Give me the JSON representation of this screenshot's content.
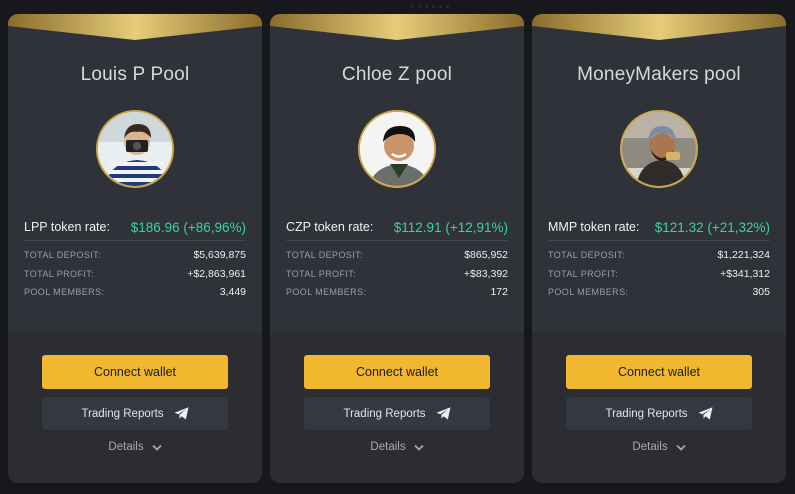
{
  "pools": [
    {
      "title": "Louis P Pool",
      "rate_label": "LPP token rate:",
      "rate_value": "$186.96 (+86,96%)",
      "total_deposit_label": "TOTAL DEPOSIT:",
      "total_deposit": "$5,639,875",
      "total_profit_label": "TOTAL PROFIT:",
      "total_profit": "+$2,863,961",
      "members_label": "POOL MEMBERS:",
      "members": "3,449",
      "connect_label": "Connect wallet",
      "reports_label": "Trading Reports",
      "details_label": "Details"
    },
    {
      "title": "Chloe Z pool",
      "rate_label": "CZP token rate:",
      "rate_value": "$112.91 (+12,91%)",
      "total_deposit_label": "TOTAL DEPOSIT:",
      "total_deposit": "$865,952",
      "total_profit_label": "TOTAL PROFIT:",
      "total_profit": "+$83,392",
      "members_label": "POOL MEMBERS:",
      "members": "172",
      "connect_label": "Connect wallet",
      "reports_label": "Trading Reports",
      "details_label": "Details"
    },
    {
      "title": "MoneyMakers pool",
      "rate_label": "MMP token rate:",
      "rate_value": "$121.32 (+21,32%)",
      "total_deposit_label": "TOTAL DEPOSIT:",
      "total_deposit": "$1,221,324",
      "total_profit_label": "TOTAL PROFIT:",
      "total_profit": "+$341,312",
      "members_label": "POOL MEMBERS:",
      "members": "305",
      "connect_label": "Connect wallet",
      "reports_label": "Trading Reports",
      "details_label": "Details"
    }
  ],
  "icons": {
    "reports": "telegram-send-icon",
    "details": "chevron-down-icon"
  },
  "colors": {
    "accent": "#f1b72e",
    "gold": "#c9a64a",
    "positive": "#3dd29c",
    "card": "#2b2d33",
    "background": "#17181c"
  }
}
